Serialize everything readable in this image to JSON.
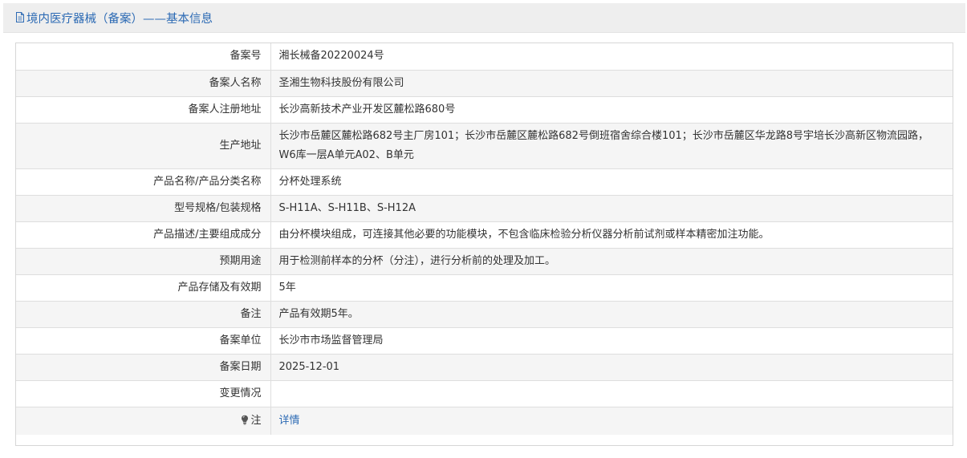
{
  "header": {
    "title": "境内医疗器械（备案）——基本信息",
    "icon": "document-icon"
  },
  "rows": [
    {
      "label": "备案号",
      "value": "湘长械备20220024号"
    },
    {
      "label": "备案人名称",
      "value": "圣湘生物科技股份有限公司"
    },
    {
      "label": "备案人注册地址",
      "value": "长沙高新技术产业开发区麓松路680号"
    },
    {
      "label": "生产地址",
      "value": "长沙市岳麓区麓松路682号主厂房101；长沙市岳麓区麓松路682号倒班宿舍综合楼101；长沙市岳麓区华龙路8号宇培长沙高新区物流园路，W6库一层A单元A02、B单元"
    },
    {
      "label": "产品名称/产品分类名称",
      "value": "分杯处理系统"
    },
    {
      "label": "型号规格/包装规格",
      "value": "S-H11A、S-H11B、S-H12A"
    },
    {
      "label": "产品描述/主要组成成分",
      "value": "由分杯模块组成，可连接其他必要的功能模块，不包含临床检验分析仪器分析前试剂或样本精密加注功能。"
    },
    {
      "label": "预期用途",
      "value": "用于检测前样本的分杯（分注），进行分析前的处理及加工。"
    },
    {
      "label": "产品存储及有效期",
      "value": "5年"
    },
    {
      "label": "备注",
      "value": "产品有效期5年。"
    },
    {
      "label": "备案单位",
      "value": "长沙市市场监督管理局"
    },
    {
      "label": "备案日期",
      "value": "2025-12-01"
    },
    {
      "label": "变更情况",
      "value": ""
    }
  ],
  "note": {
    "label": "注",
    "icon": "lightbulb-icon",
    "link_text": "详情"
  },
  "colors": {
    "accent": "#2c6ab4",
    "alt_row": "#f5f5f5",
    "header_bg": "#eeeeee"
  }
}
